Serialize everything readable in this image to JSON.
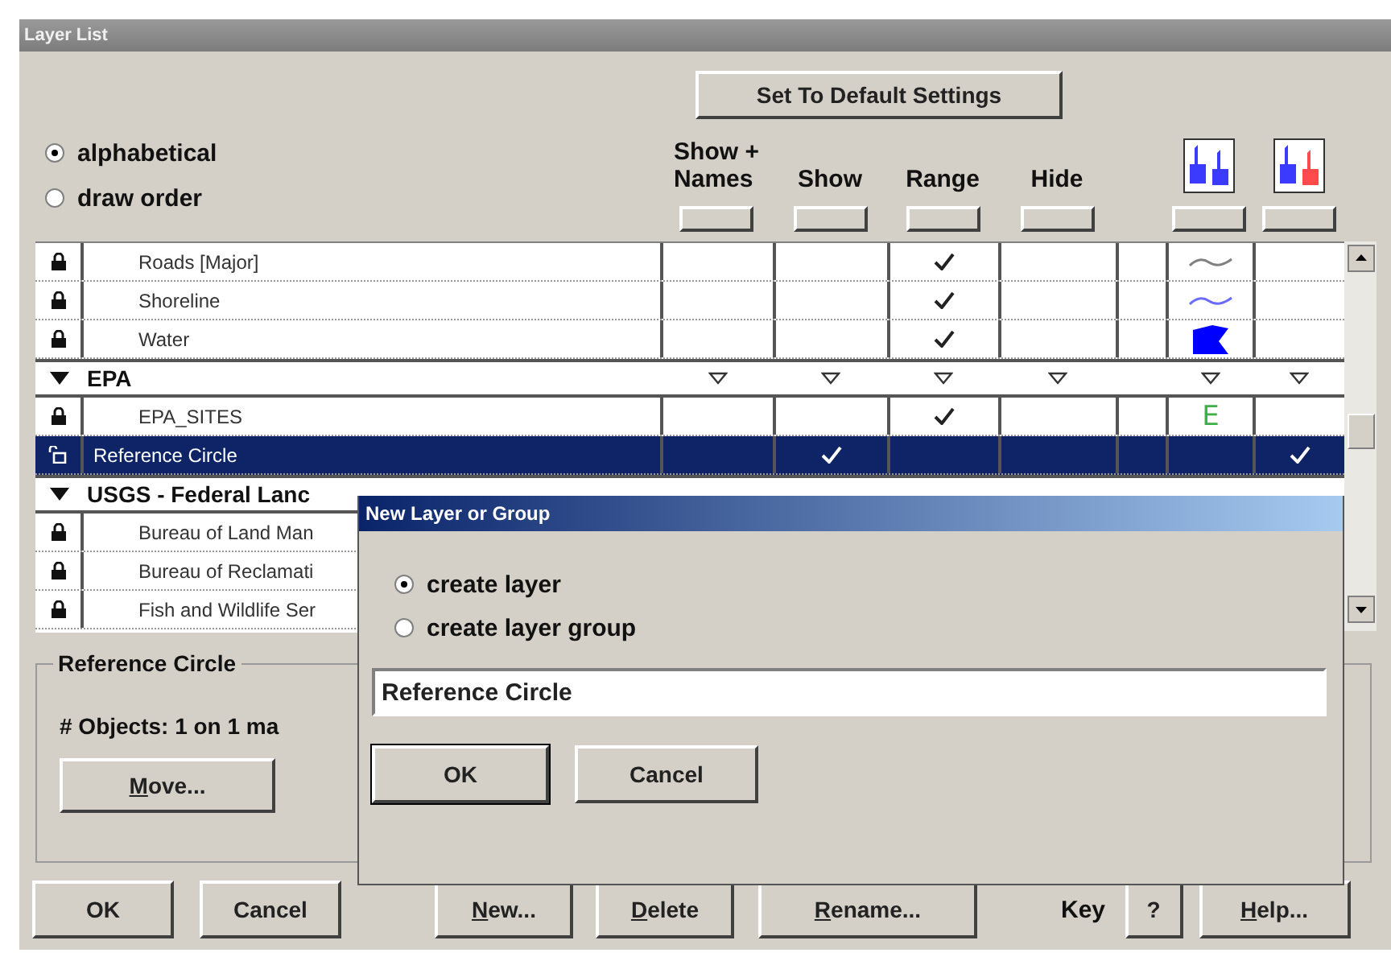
{
  "window": {
    "title": "Layer List"
  },
  "default_button": {
    "label": "Set To Default Settings"
  },
  "order_options": [
    {
      "label": "alphabetical",
      "selected": true
    },
    {
      "label": "draw order",
      "selected": false
    }
  ],
  "columns": [
    {
      "kind": "text",
      "label": "Show +\nNames"
    },
    {
      "kind": "text",
      "label": "Show"
    },
    {
      "kind": "text",
      "label": "Range"
    },
    {
      "kind": "text",
      "label": "Hide"
    },
    {
      "kind": "blank"
    },
    {
      "kind": "icon",
      "color": "#3b3bff"
    },
    {
      "kind": "icon",
      "color": "#ff4b4b"
    }
  ],
  "rows": [
    {
      "kind": "layer",
      "name": "Roads [Major]",
      "locked": true,
      "selected": false,
      "covered": false,
      "show_names": false,
      "show": false,
      "range": true,
      "hide": false,
      "symbol": {
        "kind": "line",
        "color": "#808080"
      },
      "extra": false
    },
    {
      "kind": "layer",
      "name": "Shoreline",
      "locked": true,
      "selected": false,
      "covered": false,
      "show_names": false,
      "show": false,
      "range": true,
      "hide": false,
      "symbol": {
        "kind": "line",
        "color": "#6b6bff"
      },
      "extra": false
    },
    {
      "kind": "layer",
      "name": "Water",
      "locked": true,
      "selected": false,
      "covered": false,
      "show_names": false,
      "show": false,
      "range": true,
      "hide": false,
      "symbol": {
        "kind": "fill",
        "color": "#0000ff"
      },
      "extra": false
    },
    {
      "kind": "group",
      "name": "EPA",
      "expanded": true,
      "covered": false
    },
    {
      "kind": "layer",
      "name": "EPA_SITES",
      "locked": true,
      "selected": false,
      "covered": false,
      "show_names": false,
      "show": false,
      "range": true,
      "hide": false,
      "symbol": {
        "kind": "letter",
        "text": "E",
        "color": "#3cb043"
      },
      "extra": false
    },
    {
      "kind": "layer",
      "name": "Reference Circle",
      "locked": false,
      "selected": true,
      "covered": false,
      "show_names": false,
      "show": true,
      "range": false,
      "hide": false,
      "extra": true
    },
    {
      "kind": "group",
      "name": "USGS - Federal Lanc",
      "expanded": true,
      "covered": true
    },
    {
      "kind": "layer",
      "name": "Bureau of Land Man",
      "locked": true,
      "selected": false,
      "covered": true
    },
    {
      "kind": "layer",
      "name": "Bureau of Reclamati",
      "locked": true,
      "selected": false,
      "covered": true
    },
    {
      "kind": "layer",
      "name": "Fish and Wildlife Ser",
      "locked": true,
      "selected": false,
      "covered": true
    }
  ],
  "details": {
    "title": "Reference Circle",
    "objects": "# Objects: 1 on 1 ma",
    "move_button": {
      "label": "Move...",
      "underlined": true
    }
  },
  "buttons": [
    {
      "kind": "button",
      "label": "OK",
      "underlined": false
    },
    {
      "kind": "button",
      "label": "Cancel",
      "underlined": false
    },
    {
      "kind": "button",
      "label": "New...",
      "underlined": true
    },
    {
      "kind": "button",
      "label": "Delete",
      "underlined": true
    },
    {
      "kind": "button",
      "label": "Rename...",
      "underlined": true
    },
    {
      "kind": "label",
      "label": "Key"
    },
    {
      "kind": "button",
      "label": "?",
      "underlined": false
    },
    {
      "kind": "button",
      "label": "Help...",
      "underlined": true
    }
  ],
  "dialog": {
    "title": "New Layer or Group",
    "options": [
      {
        "label": "create layer",
        "selected": true
      },
      {
        "label": "create layer group",
        "selected": false
      }
    ],
    "name_value": "Reference Circle",
    "buttons": [
      {
        "label": "OK",
        "default": true
      },
      {
        "label": "Cancel",
        "default": false
      }
    ]
  }
}
